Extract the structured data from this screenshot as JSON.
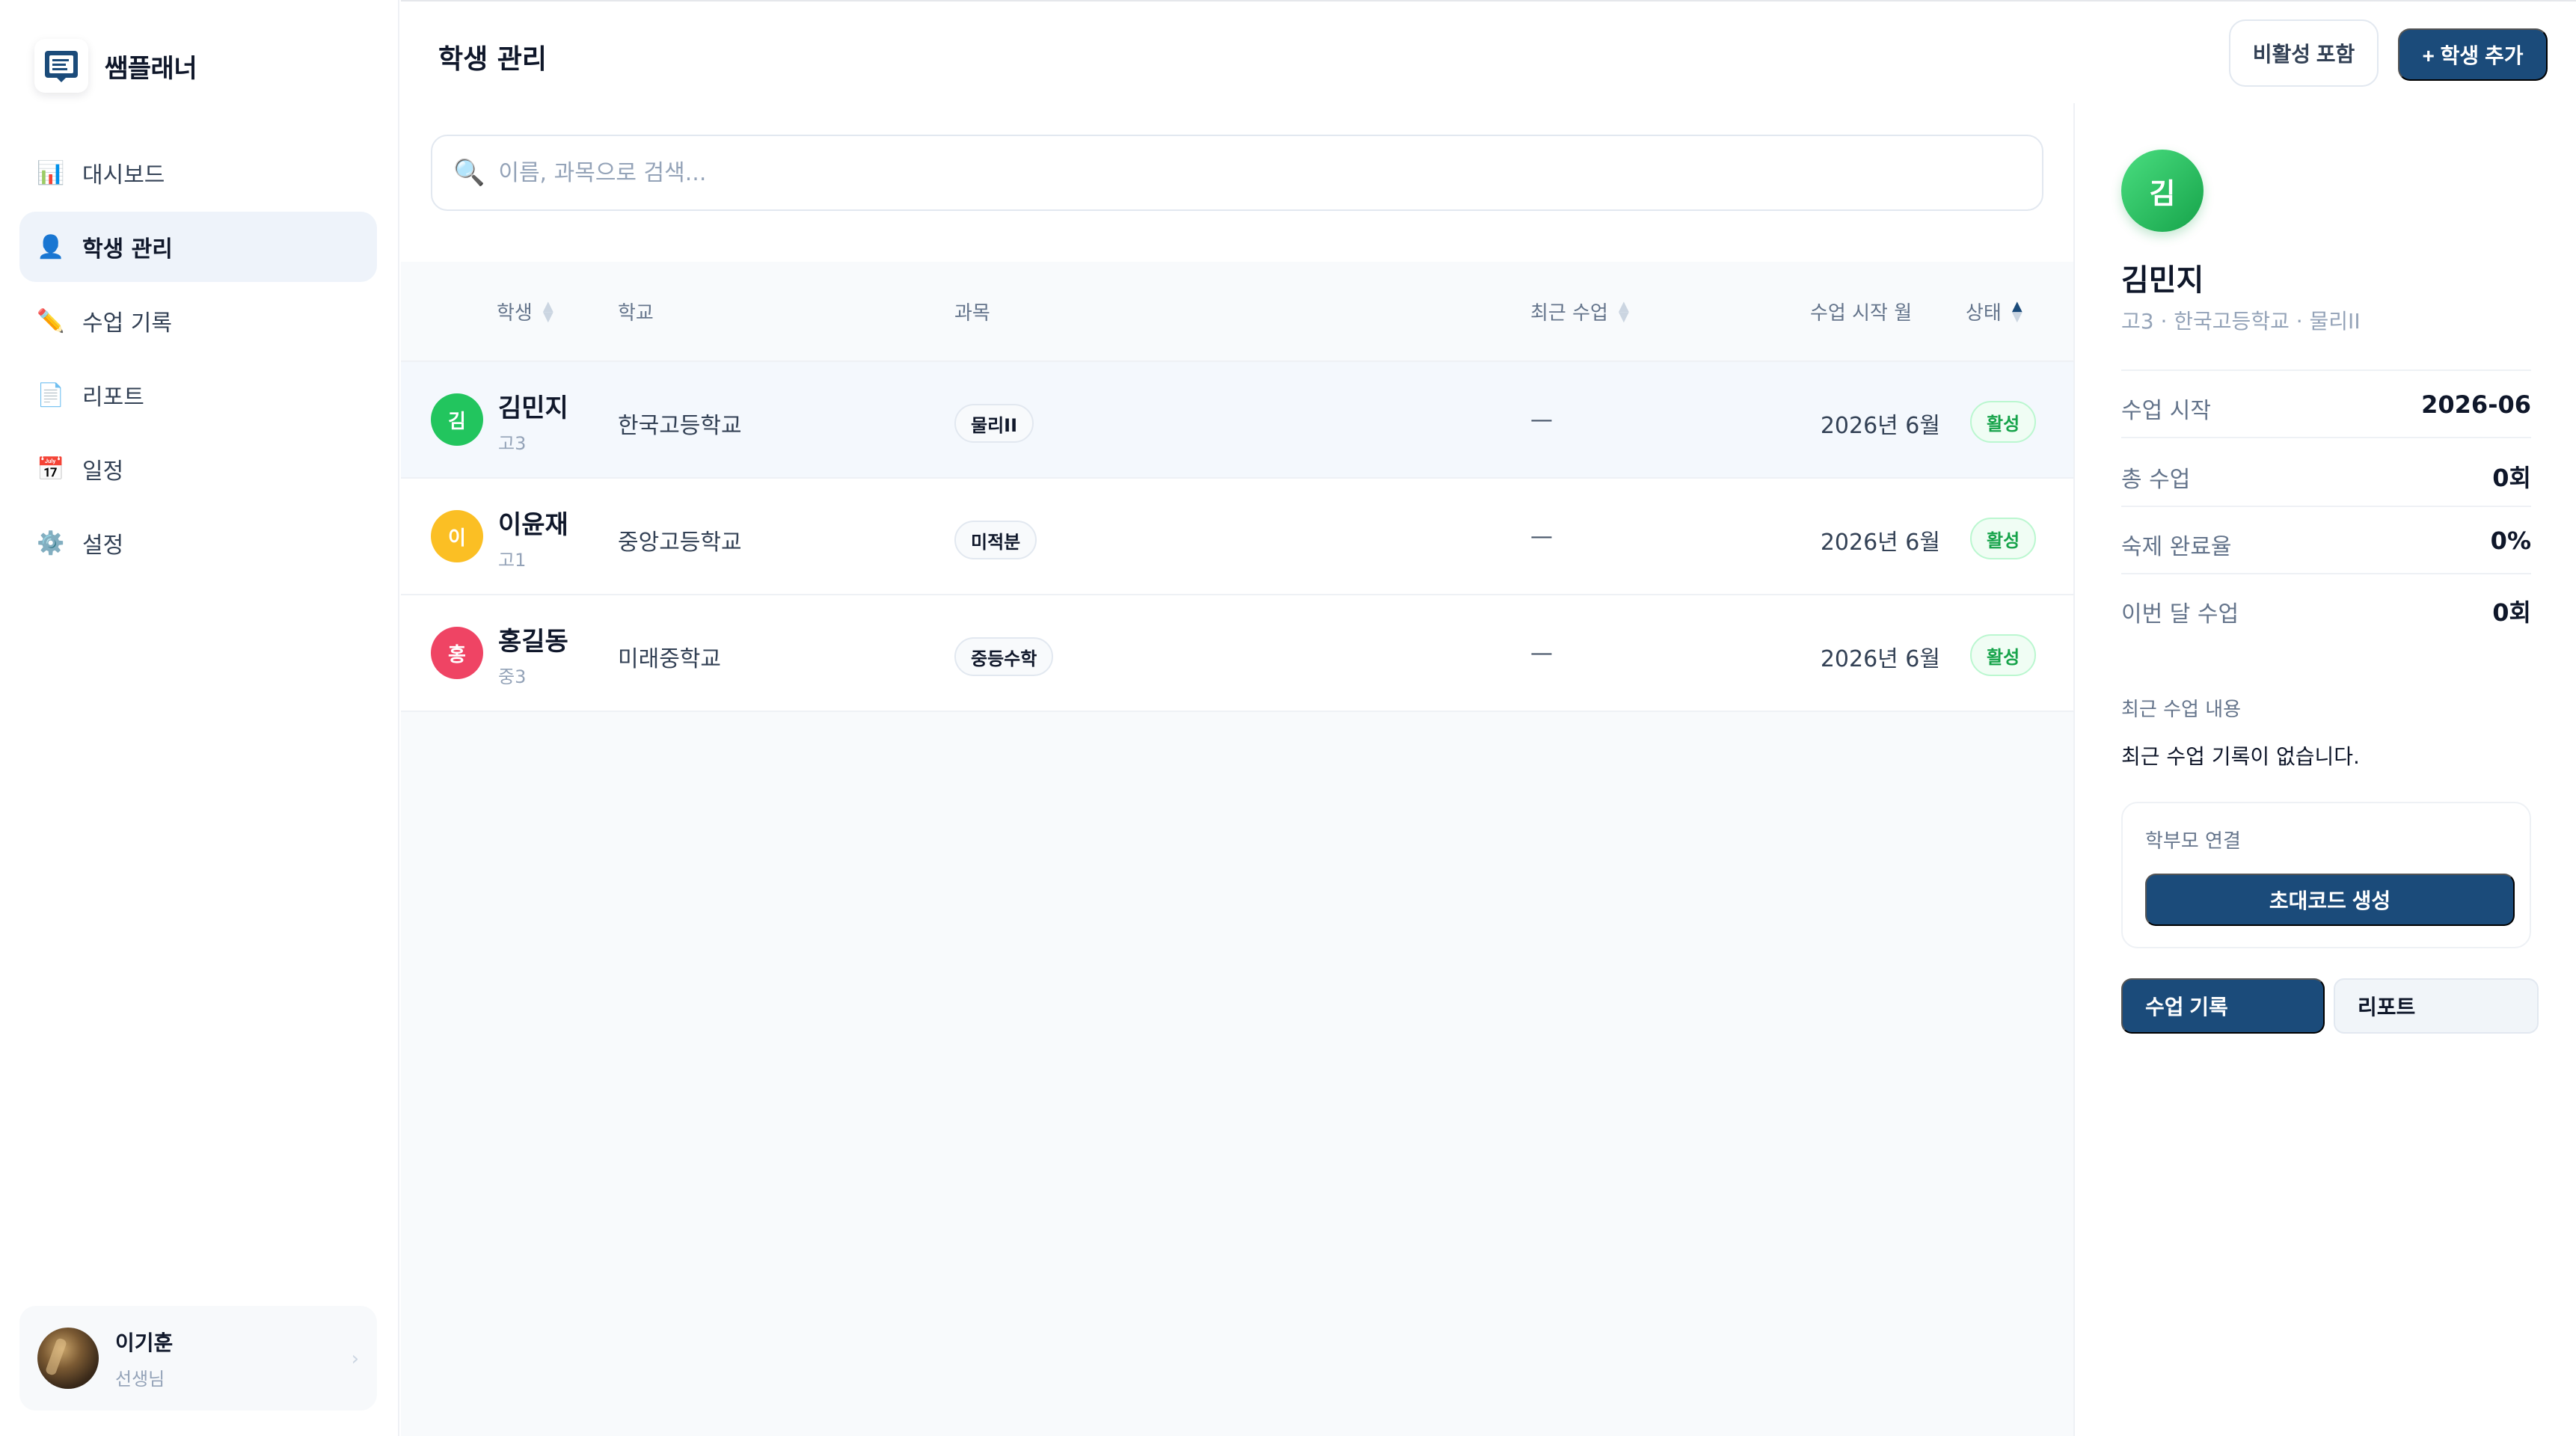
{
  "app": {
    "name": "쌤플래너",
    "logo_icon": "planner-logo-icon"
  },
  "sidebar": {
    "items": [
      {
        "label": "대시보드",
        "icon": "📊"
      },
      {
        "label": "학생 관리",
        "icon": "👤",
        "active": true
      },
      {
        "label": "수업 기록",
        "icon": "✏️"
      },
      {
        "label": "리포트",
        "icon": "📄"
      },
      {
        "label": "일정",
        "icon": "📅"
      },
      {
        "label": "설정",
        "icon": "⚙️"
      }
    ],
    "profile": {
      "name": "이기훈",
      "role": "선생님",
      "chevron": "›"
    }
  },
  "header": {
    "title": "학생 관리",
    "inactive_toggle": "비활성 포함",
    "add_button": "+ 학생 추가"
  },
  "search": {
    "placeholder": "이름, 과목으로 검색...",
    "icon": "🔍"
  },
  "table": {
    "columns": {
      "student": "학생",
      "school": "학교",
      "subject": "과목",
      "recent": "최근 수업",
      "start": "수업 시작 월",
      "status": "상태"
    },
    "rows": [
      {
        "initial": "김",
        "name": "김민지",
        "grade": "고3",
        "school": "한국고등학교",
        "subject": "물리II",
        "recent": "—",
        "start": "2026년 6월",
        "status": "활성",
        "avatar_color": "#22c55e"
      },
      {
        "initial": "이",
        "name": "이윤재",
        "grade": "고1",
        "school": "중앙고등학교",
        "subject": "미적분",
        "recent": "—",
        "start": "2026년 6월",
        "status": "활성",
        "avatar_color": "#fbbf24"
      },
      {
        "initial": "홍",
        "name": "홍길동",
        "grade": "중3",
        "school": "미래중학교",
        "subject": "중등수학",
        "recent": "—",
        "start": "2026년 6월",
        "status": "활성",
        "avatar_color": "#ef4464"
      }
    ]
  },
  "detail": {
    "initial": "김",
    "name": "김민지",
    "subtitle": "고3 · 한국고등학교 · 물리II",
    "stats": [
      {
        "label": "수업 시작",
        "value": "2026-06"
      },
      {
        "label": "총 수업",
        "value": "0회"
      },
      {
        "label": "숙제 완료율",
        "value": "0%"
      },
      {
        "label": "이번 달 수업",
        "value": "0회"
      }
    ],
    "recent_label": "최근 수업 내용",
    "recent_text": "최근 수업 기록이 없습니다.",
    "parent_title": "학부모 연결",
    "invite_button": "초대코드 생성",
    "tab_primary": "수업 기록",
    "tab_secondary": "리포트"
  },
  "colors": {
    "primary": "#1b4b7a",
    "active_status": "#16a34a",
    "sidebar_active_bg": "#eef3fa"
  }
}
